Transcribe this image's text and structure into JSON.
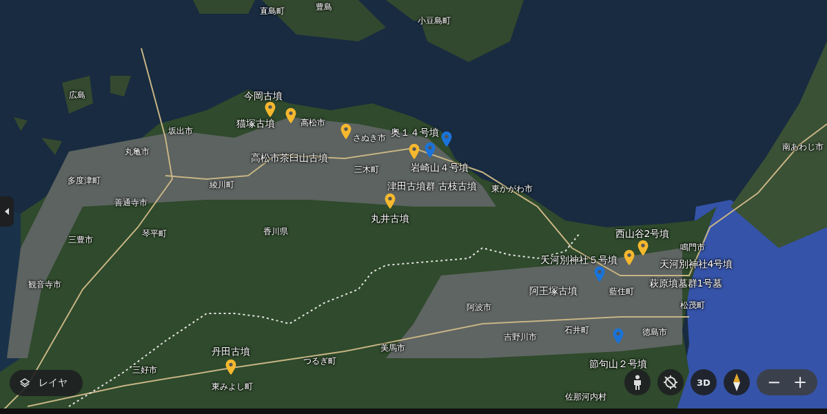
{
  "towns": [
    {
      "name": "直島町"
    },
    {
      "name": "豊島"
    },
    {
      "name": "小豆島町"
    },
    {
      "name": "広島"
    },
    {
      "name": "坂出市"
    },
    {
      "name": "丸亀市"
    },
    {
      "name": "多度津町"
    },
    {
      "name": "善通寺市"
    },
    {
      "name": "綾川町"
    },
    {
      "name": "高松市"
    },
    {
      "name": "さぬき市"
    },
    {
      "name": "三木町"
    },
    {
      "name": "東かがわ市"
    },
    {
      "name": "南あわじ市"
    },
    {
      "name": "三豊市"
    },
    {
      "name": "琴平町"
    },
    {
      "name": "香川県"
    },
    {
      "name": "観音寺市"
    },
    {
      "name": "三好市"
    },
    {
      "name": "つるぎ町"
    },
    {
      "name": "美馬市"
    },
    {
      "name": "東みよし町"
    },
    {
      "name": "阿波市"
    },
    {
      "name": "吉野川市"
    },
    {
      "name": "石井町"
    },
    {
      "name": "藍住町"
    },
    {
      "name": "徳島市"
    },
    {
      "name": "鳴門市"
    },
    {
      "name": "松茂町"
    },
    {
      "name": "佐那河内村"
    }
  ],
  "sites": [
    {
      "name": "今岡古墳"
    },
    {
      "name": "猫塚古墳"
    },
    {
      "name": "奥１４号墳"
    },
    {
      "name": "高松市茶臼山古墳"
    },
    {
      "name": "岩崎山４号墳"
    },
    {
      "name": "津田古墳群 古枝古墳"
    },
    {
      "name": "丸井古墳"
    },
    {
      "name": "西山谷2号墳"
    },
    {
      "name": "天河別神社５号墳"
    },
    {
      "name": "天河別神社4号墳"
    },
    {
      "name": "萩原墳墓群1号墓"
    },
    {
      "name": "阿王塚古墳"
    },
    {
      "name": "丹田古墳"
    },
    {
      "name": "節句山２号墳"
    }
  ],
  "pins": [
    {
      "color": "#f5b82e"
    },
    {
      "color": "#f5b82e"
    },
    {
      "color": "#f5b82e"
    },
    {
      "color": "#f5b82e"
    },
    {
      "color": "#1a73d9"
    },
    {
      "color": "#1a73d9"
    },
    {
      "color": "#f5b82e"
    },
    {
      "color": "#f5b82e"
    },
    {
      "color": "#f5b82e"
    },
    {
      "color": "#1a73d9"
    },
    {
      "color": "#1a73d9"
    },
    {
      "color": "#f5b82e"
    }
  ],
  "layers_button": {
    "label": "レイヤ"
  },
  "map_controls": {
    "three_d": "3D",
    "zoom_out": "−",
    "zoom_in": "+"
  }
}
